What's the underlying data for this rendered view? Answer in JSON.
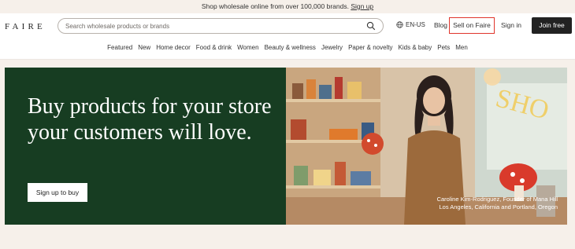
{
  "announcement": {
    "text": "Shop wholesale online from over 100,000 brands.",
    "link": "Sign up"
  },
  "header": {
    "logo": "FAIRE",
    "search_placeholder": "Search wholesale products or brands",
    "locale": "EN-US",
    "blog": "Blog",
    "sell": "Sell on Faire",
    "signin": "Sign in",
    "join": "Join free"
  },
  "nav": [
    "Featured",
    "New",
    "Home decor",
    "Food & drink",
    "Women",
    "Beauty & wellness",
    "Jewelry",
    "Paper & novelty",
    "Kids & baby",
    "Pets",
    "Men"
  ],
  "hero": {
    "headline": "Buy products for your store your customers will love.",
    "cta": "Sign up to buy",
    "caption_line1": "Caroline Kim-Rodriguez, Founder of Mana Hill",
    "caption_line2": "Los Angeles, California and Portland, Oregon"
  },
  "colors": {
    "hero_bg": "#173d22",
    "accent_outline": "#e0352b",
    "join_bg": "#222222",
    "page_bg": "#f6f0ea"
  }
}
